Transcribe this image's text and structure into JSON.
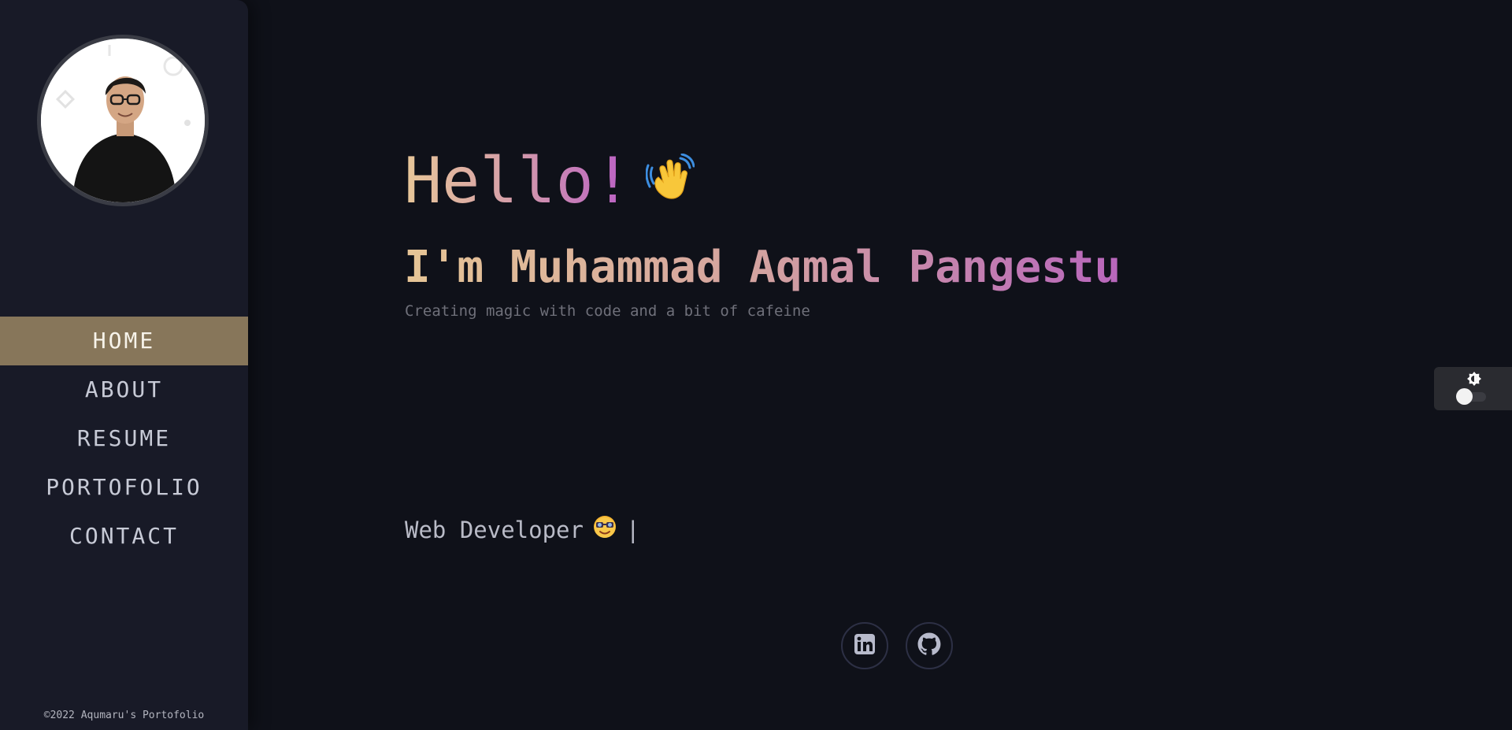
{
  "sidebar": {
    "avatar_alt": "profile photo",
    "nav": [
      {
        "label": "HOME",
        "active": true
      },
      {
        "label": "ABOUT",
        "active": false
      },
      {
        "label": "RESUME",
        "active": false
      },
      {
        "label": "PORTOFOLIO",
        "active": false
      },
      {
        "label": "CONTACT",
        "active": false
      }
    ],
    "copyright": "©2022 Aqumaru's Portofolio"
  },
  "hero": {
    "greeting": "Hello!",
    "greeting_emoji": "waving-hand-icon",
    "name": "I'm Muhammad Aqmal Pangestu",
    "tagline": "Creating magic with code and a bit of cafeine",
    "role": "Web Developer",
    "role_emoji": "star-struck-face-icon",
    "cursor": "|"
  },
  "socials": [
    {
      "icon": "linkedin-icon"
    },
    {
      "icon": "github-icon"
    }
  ],
  "theme_toggle": {
    "icon": "brightness-icon",
    "dark_mode": true
  },
  "colors": {
    "background": "#0f1119",
    "sidebar": "#181a27",
    "nav_active": "#87765a",
    "gradient_start": "#e8c799",
    "gradient_end": "#b95ec6"
  }
}
